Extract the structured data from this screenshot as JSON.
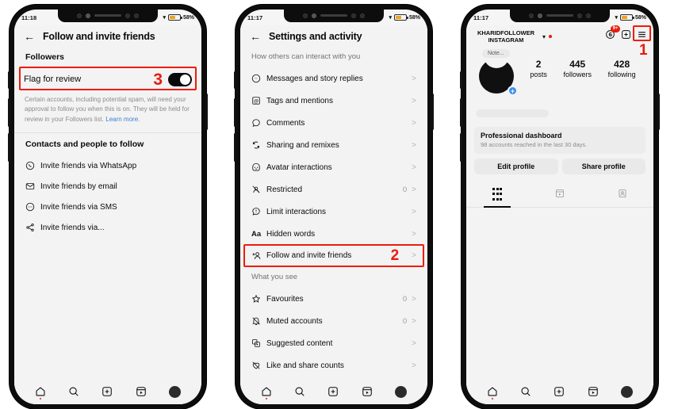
{
  "phones": [
    {
      "id": "phone-follow-invite",
      "status_bar": {
        "time": "11:18",
        "battery_percent": "58%",
        "wifi_icon": "wifi-icon",
        "battery_icon": "battery-icon"
      },
      "nav": {
        "back_icon": "back-arrow-icon",
        "title": "Follow and invite friends"
      },
      "sections": [
        {
          "label": "Followers"
        }
      ],
      "toggle_row": {
        "label": "Flag for review",
        "state": "on",
        "annotation": "3",
        "helper_text": "Certain accounts, including potential spam, will need your approval to follow you when this is on. They will be held for review in your Followers list. ",
        "helper_link": "Learn more",
        "helper_suffix": "."
      },
      "contacts_section": "Contacts and people to follow",
      "contacts": [
        {
          "icon": "whatsapp-icon",
          "label": "Invite friends via WhatsApp"
        },
        {
          "icon": "email-icon",
          "label": "Invite friends by email"
        },
        {
          "icon": "sms-icon",
          "label": "Invite friends via SMS"
        },
        {
          "icon": "share-icon",
          "label": "Invite friends via..."
        }
      ],
      "tabbar": [
        "home-icon",
        "search-icon",
        "create-icon",
        "reels-icon",
        "profile-avatar-icon"
      ]
    },
    {
      "id": "phone-settings",
      "status_bar": {
        "time": "11:17",
        "battery_percent": "58%"
      },
      "nav": {
        "back_icon": "back-arrow-icon",
        "title": "Settings and activity"
      },
      "section_interact": "How others can interact with you",
      "interact_items": [
        {
          "icon": "messenger-icon",
          "label": "Messages and story replies",
          "count": "",
          "chevron": ">"
        },
        {
          "icon": "at-mention-icon",
          "label": "Tags and mentions",
          "count": "",
          "chevron": ">"
        },
        {
          "icon": "comment-icon",
          "label": "Comments",
          "count": "",
          "chevron": ">"
        },
        {
          "icon": "sharing-remixes-icon",
          "label": "Sharing and remixes",
          "count": "",
          "chevron": ">"
        },
        {
          "icon": "avatar-interactions-icon",
          "label": "Avatar interactions",
          "count": "",
          "chevron": ">"
        },
        {
          "icon": "restricted-icon",
          "label": "Restricted",
          "count": "0",
          "chevron": ">"
        },
        {
          "icon": "limit-interactions-icon",
          "label": "Limit interactions",
          "count": "",
          "chevron": ">"
        },
        {
          "icon": "hidden-words-icon",
          "label": "Hidden words",
          "count": "",
          "chevron": ">"
        },
        {
          "icon": "follow-invite-icon",
          "label": "Follow and invite friends",
          "count": "",
          "chevron": ">",
          "annotation": "2",
          "highlighted": true
        }
      ],
      "section_see": "What you see",
      "see_items": [
        {
          "icon": "star-icon",
          "label": "Favourites",
          "count": "0",
          "chevron": ">"
        },
        {
          "icon": "muted-accounts-icon",
          "label": "Muted accounts",
          "count": "0",
          "chevron": ">"
        },
        {
          "icon": "suggested-content-icon",
          "label": "Suggested content",
          "count": "",
          "chevron": ">"
        },
        {
          "icon": "like-share-counts-icon",
          "label": "Like and share counts",
          "count": "",
          "chevron": ">"
        }
      ],
      "tabbar": [
        "home-icon",
        "search-icon",
        "create-icon",
        "reels-icon",
        "profile-avatar-icon"
      ]
    },
    {
      "id": "phone-profile",
      "status_bar": {
        "time": "11:17",
        "battery_percent": "58%"
      },
      "header": {
        "username_line1": "KHARIDFOLLOWER",
        "username_line2": "INSTAGRAM",
        "caret_icon": "chevron-down-icon",
        "red_dot": "notification-dot",
        "threads_icon": "threads-icon",
        "threads_badge": "9+",
        "create_icon": "create-plus-icon",
        "menu_icon": "hamburger-menu-icon",
        "annotation": "1"
      },
      "note_bubble": "Note...",
      "avatar_plus": "+",
      "stats": [
        {
          "num": "2",
          "cap": "posts"
        },
        {
          "num": "445",
          "cap": "followers"
        },
        {
          "num": "428",
          "cap": "following"
        }
      ],
      "dashboard": {
        "title": "Professional dashboard",
        "subtitle": "98 accounts reached in the last 30 days."
      },
      "buttons": [
        {
          "label": "Edit profile"
        },
        {
          "label": "Share profile"
        }
      ],
      "tabs": [
        {
          "icon": "grid-posts-icon",
          "active": true
        },
        {
          "icon": "reels-tab-icon",
          "active": false
        },
        {
          "icon": "tagged-tab-icon",
          "active": false
        }
      ],
      "tabbar": [
        "home-icon",
        "search-icon",
        "create-icon",
        "reels-icon",
        "profile-avatar-icon"
      ]
    }
  ],
  "colors": {
    "annotation_red": "#ef1b0c",
    "link_blue": "#3a7fd5",
    "accent_blue": "#3a8ef0",
    "battery_orange": "#f0a11e"
  }
}
